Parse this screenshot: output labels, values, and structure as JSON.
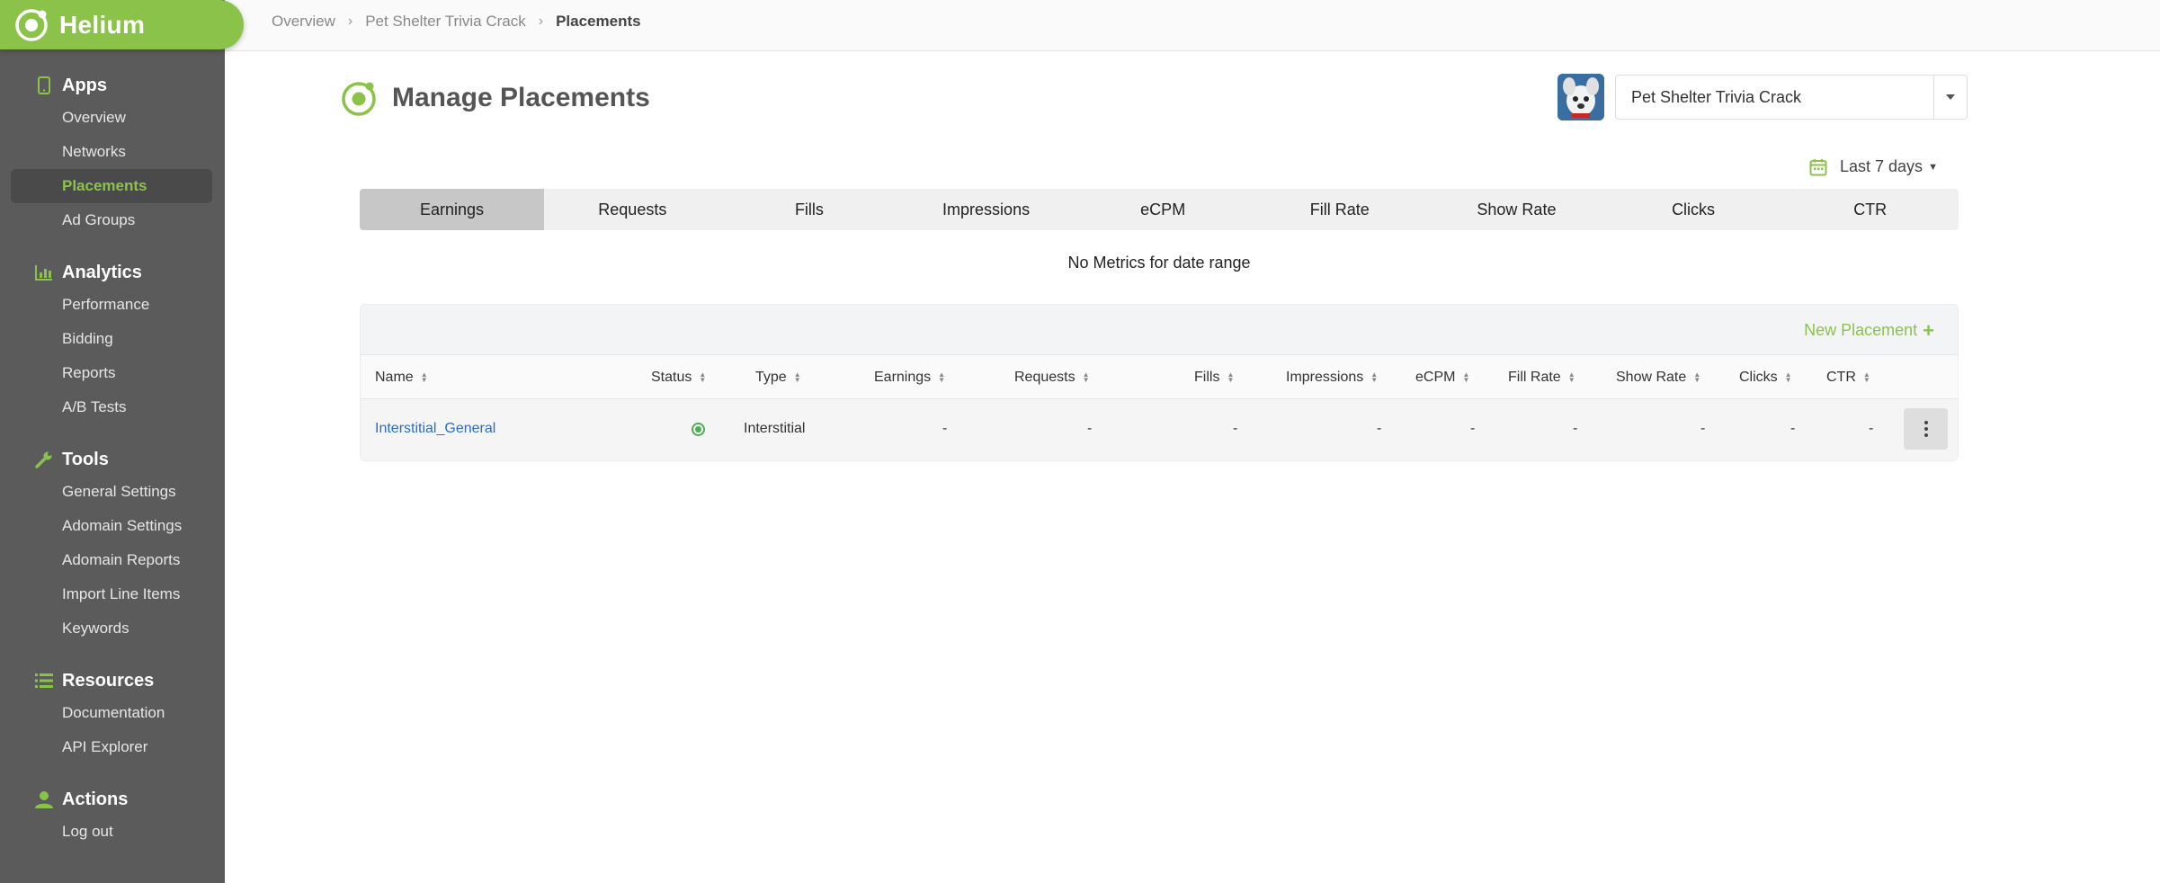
{
  "brand": {
    "name": "Helium",
    "accent": "#8bc34a"
  },
  "sidebar": {
    "sections": [
      {
        "title": "Apps",
        "icon": "phone-icon",
        "items": [
          "Overview",
          "Networks",
          "Placements",
          "Ad Groups"
        ],
        "active": "Placements"
      },
      {
        "title": "Analytics",
        "icon": "bar-chart-icon",
        "items": [
          "Performance",
          "Bidding",
          "Reports",
          "A/B Tests"
        ]
      },
      {
        "title": "Tools",
        "icon": "wrench-icon",
        "items": [
          "General Settings",
          "Adomain Settings",
          "Adomain Reports",
          "Import Line Items",
          "Keywords"
        ]
      },
      {
        "title": "Resources",
        "icon": "list-icon",
        "items": [
          "Documentation",
          "API Explorer"
        ]
      },
      {
        "title": "Actions",
        "icon": "user-icon",
        "items": [
          "Log out"
        ]
      }
    ]
  },
  "breadcrumb": {
    "items": [
      "Overview",
      "Pet Shelter Trivia Crack"
    ],
    "current": "Placements"
  },
  "header": {
    "title": "Manage Placements"
  },
  "app_selector": {
    "value": "Pet Shelter Trivia Crack"
  },
  "date_range": {
    "label": "Last 7 days"
  },
  "metric_tabs": [
    "Earnings",
    "Requests",
    "Fills",
    "Impressions",
    "eCPM",
    "Fill Rate",
    "Show Rate",
    "Clicks",
    "CTR"
  ],
  "metric_tabs_active": "Earnings",
  "no_metrics_text": "No Metrics for date range",
  "table": {
    "new_placement_label": "New Placement",
    "columns": [
      "Name",
      "Status",
      "Type",
      "Earnings",
      "Requests",
      "Fills",
      "Impressions",
      "eCPM",
      "Fill Rate",
      "Show Rate",
      "Clicks",
      "CTR"
    ],
    "rows": [
      {
        "name": "Interstitial_General",
        "status": "active",
        "type": "Interstitial",
        "earnings": "-",
        "requests": "-",
        "fills": "-",
        "impressions": "-",
        "ecpm": "-",
        "fill_rate": "-",
        "show_rate": "-",
        "clicks": "-",
        "ctr": "-"
      }
    ]
  }
}
